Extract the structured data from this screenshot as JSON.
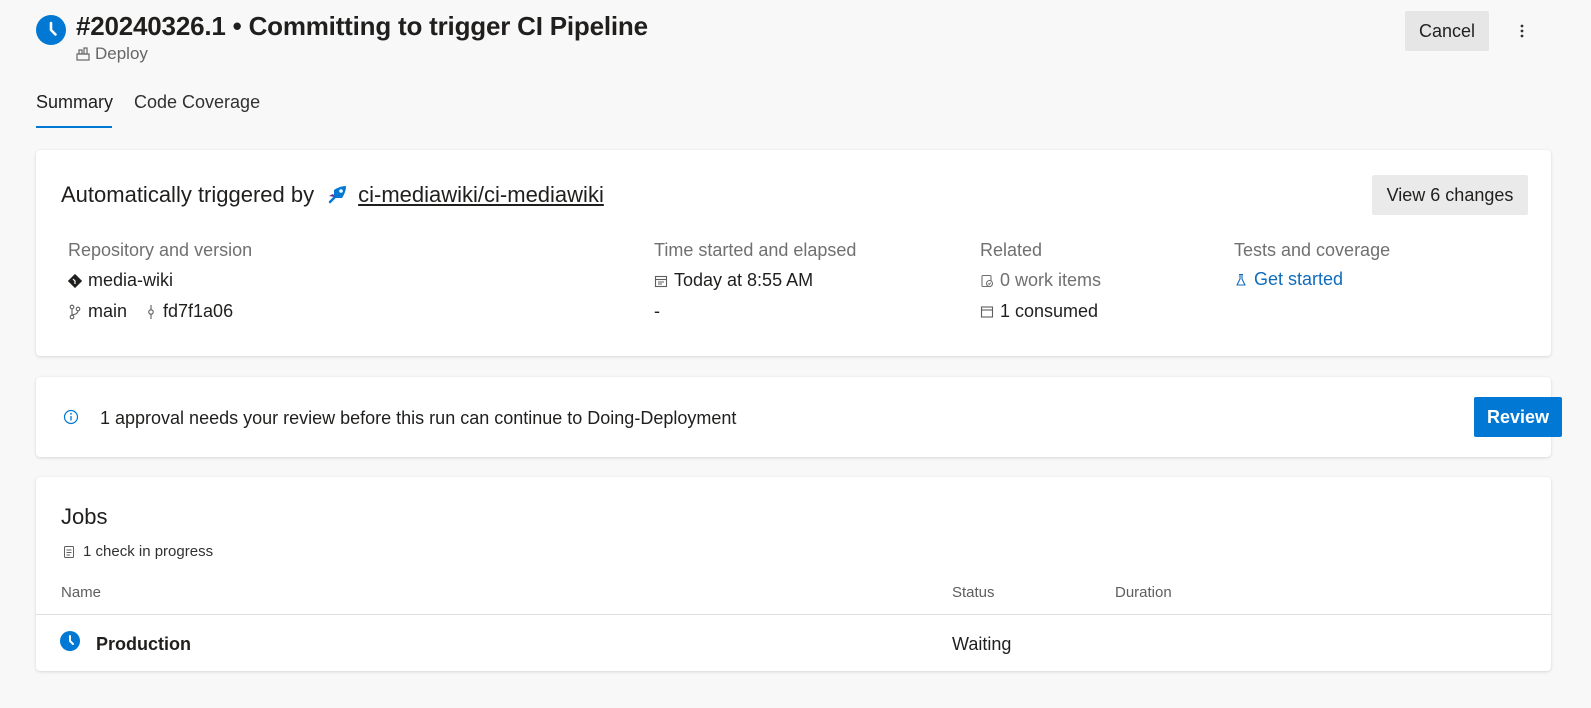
{
  "header": {
    "run_title": "#20240326.1 • Committing to trigger CI Pipeline",
    "stage_label": "Deploy",
    "cancel_label": "Cancel",
    "status_color": "#0078d4"
  },
  "tabs": [
    {
      "label": "Summary",
      "active": true
    },
    {
      "label": "Code Coverage",
      "active": false
    }
  ],
  "trigger": {
    "prefix": "Automatically triggered by",
    "pipeline_link": "ci-mediawiki/ci-mediawiki",
    "view_changes_label": "View 6 changes"
  },
  "details": {
    "repository": {
      "label": "Repository and version",
      "repo_name": "media-wiki",
      "branch": "main",
      "commit": "fd7f1a06"
    },
    "time": {
      "label": "Time started and elapsed",
      "started": "Today at 8:55 AM",
      "elapsed": "-"
    },
    "related": {
      "label": "Related",
      "work_items": "0 work items",
      "consumed": "1 consumed"
    },
    "tests": {
      "label": "Tests and coverage",
      "link": "Get started"
    }
  },
  "approval": {
    "message": "1 approval needs your review before this run can continue to Doing-Deployment",
    "review_label": "Review"
  },
  "jobs": {
    "title": "Jobs",
    "checks": "1 check in progress",
    "columns": {
      "name": "Name",
      "status": "Status",
      "duration": "Duration"
    },
    "rows": [
      {
        "name": "Production",
        "status": "Waiting",
        "duration": ""
      }
    ]
  },
  "icons": [
    "clock-status-icon",
    "stage-icon",
    "more-options-icon",
    "pipeline-icon",
    "repo-icon",
    "branch-icon",
    "commit-icon",
    "calendar-icon",
    "work-item-icon",
    "artifact-icon",
    "beaker-icon",
    "info-icon",
    "checklist-icon"
  ]
}
